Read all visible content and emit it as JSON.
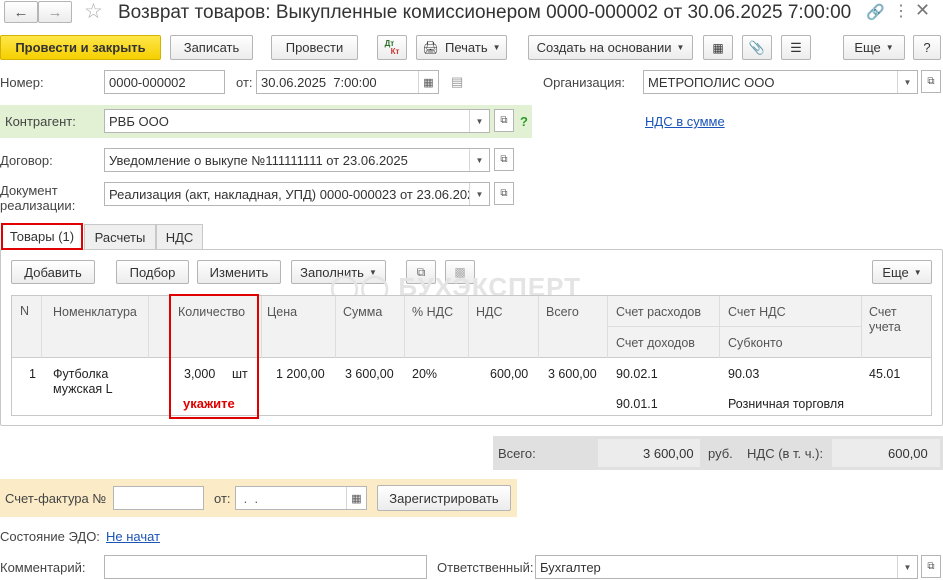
{
  "window": {
    "title": "Возврат товаров: Выкупленные комиссионером 0000-000002 от 30.06.2025 7:00:00"
  },
  "toolbar": {
    "post_and_close": "Провести и закрыть",
    "save": "Записать",
    "post": "Провести",
    "dtkt_top": "Дт",
    "dtkt_bottom": "Кт",
    "print": "Печать",
    "create_based_on": "Создать на основании",
    "more": "Еще"
  },
  "header": {
    "number_label": "Номер:",
    "number_value": "0000-000002",
    "date_label": "от:",
    "date_value": "30.06.2025  7:00:00",
    "org_label": "Организация:",
    "org_value": "МЕТРОПОЛИС ООО",
    "counterparty_label": "Контрагент:",
    "counterparty_value": "РВБ ООО",
    "help_mark": "?",
    "vat_link": "НДС в сумме",
    "contract_label": "Договор:",
    "contract_value": "Уведомление о выкупе №111111111 от 23.06.2025",
    "sales_doc_label": "Документ реализации:",
    "sales_doc_value": "Реализация (акт, накладная, УПД) 0000-000023 от 23.06.202"
  },
  "tabs": [
    {
      "label": "Товары (1)",
      "active": true
    },
    {
      "label": "Расчеты",
      "active": false
    },
    {
      "label": "НДС",
      "active": false
    }
  ],
  "table_toolbar": {
    "add": "Добавить",
    "pick": "Подбор",
    "change": "Изменить",
    "fill": "Заполнить",
    "more": "Еще"
  },
  "watermark": "БУХЭКСПЕРТ",
  "table": {
    "columns": {
      "n": "N",
      "item": "Номенклатура",
      "qty": "Количество",
      "price": "Цена",
      "sum": "Сумма",
      "vat_pct": "% НДС",
      "vat": "НДС",
      "total": "Всего",
      "expense_account": "Счет расходов",
      "income_account": "Счет доходов",
      "vat_account": "Счет НДС",
      "subconto": "Субконто",
      "account": "Счет учета"
    },
    "rows": [
      {
        "n": "1",
        "item_line1": "Футболка",
        "item_line2": "мужская L",
        "qty": "3,000",
        "unit": "шт",
        "price": "1 200,00",
        "sum": "3 600,00",
        "vat_pct": "20%",
        "vat": "600,00",
        "total": "3 600,00",
        "expense_account": "90.02.1",
        "income_account": "90.01.1",
        "vat_account": "90.03",
        "subconto": "Розничная торговля",
        "account": "45.01"
      }
    ],
    "annotation": "укажите"
  },
  "totals": {
    "total_label": "Всего:",
    "total_value": "3 600,00",
    "currency": "руб.",
    "vat_label": "НДС (в т. ч.):",
    "vat_value": "600,00"
  },
  "invoice": {
    "label": "Счет-фактура №",
    "number_value": "",
    "date_label": "от:",
    "date_value": " .  .",
    "register_button": "Зарегистрировать"
  },
  "edo": {
    "label": "Состояние ЭДО:",
    "value": "Не начат"
  },
  "footer": {
    "comment_label": "Комментарий:",
    "comment_value": "",
    "responsible_label": "Ответственный:",
    "responsible_value": "Бухгалтер"
  },
  "colors": {
    "accent_yellow": "#f5d000",
    "highlight_red": "#e00000",
    "counterparty_bg": "#e2f1d4",
    "invoice_bg": "#fbecc7",
    "link_blue": "#1a54b8"
  }
}
